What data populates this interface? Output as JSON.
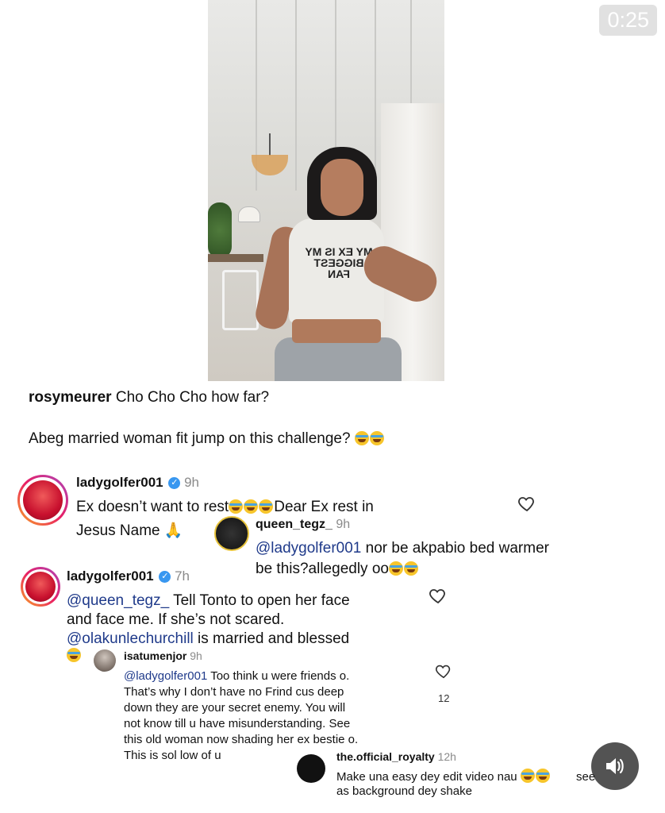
{
  "video": {
    "timer": "0:25",
    "shirt_text": "MY EX IS MY BIGGEST FAN"
  },
  "post_caption": {
    "username": "rosymeurer",
    "line1": "Cho Cho Cho how far?",
    "line2": "Abeg married woman fit jump on this challenge?"
  },
  "comments": [
    {
      "username": "ladygolfer001",
      "time": "9h",
      "line1": "Ex doesn’t want to rest",
      "line1b": "Dear Ex rest in",
      "line2": "Jesus Name"
    },
    {
      "username": "queen_tegz_",
      "time": "9h",
      "mention": "@ladygolfer001",
      "line1": "nor be akpabio bed warmer",
      "line2": "be this?allegedly oo"
    },
    {
      "username": "ladygolfer001",
      "time": "7h",
      "mention": "@queen_tegz_",
      "line1": "Tell Tonto to open her face",
      "line2": "and face me. If she’s not scared.",
      "mention2": "@olakunlechurchill",
      "line3": "is married and blessed"
    },
    {
      "username": "isatumenjor",
      "time": "9h",
      "mention": "@ladygolfer001",
      "line1": "Too think u were friends o.",
      "line2": "That’s why I don’t have no Frind cus deep",
      "line3": "down they are your secret enemy. You will",
      "line4": "not know till u have misunderstanding. See",
      "line5": "this old woman now shading her ex bestie o.",
      "line6": "This is sol low of u",
      "likes": "12"
    },
    {
      "username": "the.official_royalty",
      "time": "12h",
      "line1": "Make una easy dey edit video nau",
      "line1b": "see",
      "line2": "as background dey shake"
    }
  ],
  "icons": [
    "heart-icon",
    "verified-badge-icon",
    "speaker-icon"
  ],
  "colors": {
    "mention": "#1f3a8a",
    "verified": "#3897f0",
    "muted": "#8a8a8a"
  }
}
